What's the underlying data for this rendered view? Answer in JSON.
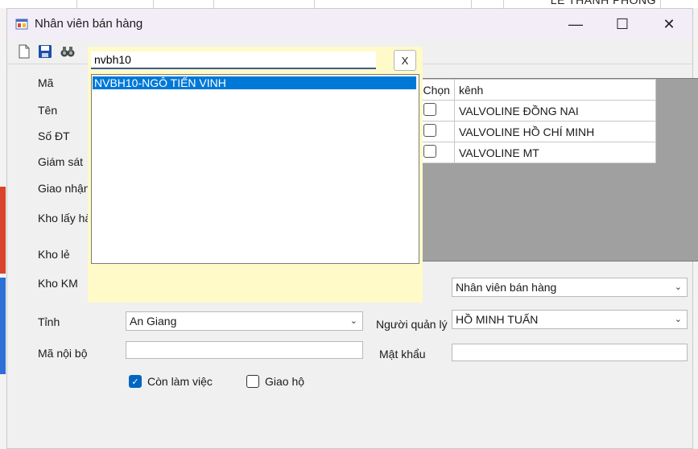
{
  "background": {
    "person_name": "LÊ THÀNH PHONG"
  },
  "window": {
    "title": "Nhân viên bán hàng",
    "minimize_glyph": "—",
    "maximize_glyph": "☐",
    "close_glyph": "✕"
  },
  "toolbar": {
    "icons": [
      "new-file-icon",
      "save-icon",
      "search-binoculars-icon"
    ]
  },
  "form": {
    "labels": {
      "ma": "Mã",
      "ten": "Tên",
      "so_dt": "Số ĐT",
      "giam_sat": "Giám sát",
      "giao_nhan": "Giao nhận",
      "kho_lay_hang": "Kho lấy hàn",
      "kho_le": "Kho lẻ",
      "kho_km": "Kho KM",
      "tinh": "Tỉnh",
      "ma_noi_bo": "Mã nội bộ",
      "nguoi_quan_ly": "Người quản lý",
      "mat_khau": "Mật khẩu"
    },
    "tinh_value": "An Giang",
    "role_value": "Nhân viên bán hàng",
    "nguoi_quan_ly_value": "HỒ MINH TUẤN",
    "ma_noi_bo_value": "",
    "mat_khau_value": "",
    "con_lam_viec": {
      "label": "Còn làm việc",
      "checked": true
    },
    "giao_ho": {
      "label": "Giao hộ",
      "checked": false
    }
  },
  "grid": {
    "headers": {
      "chon": "Chọn",
      "kenh": "kênh"
    },
    "rows": [
      {
        "kenh": "VALVOLINE ĐỒNG NAI",
        "checked": false
      },
      {
        "kenh": "VALVOLINE HỒ CHÍ MINH",
        "checked": false
      },
      {
        "kenh": "VALVOLINE MT",
        "checked": false
      }
    ]
  },
  "popup": {
    "search_value": "nvbh10",
    "close_label": "X",
    "items": [
      "NVBH10-NGÔ TIẾN VINH"
    ]
  },
  "colors": {
    "accent": "#0078d7",
    "popup_bg": "#fffac8",
    "grid_bg": "#a0a0a0"
  }
}
